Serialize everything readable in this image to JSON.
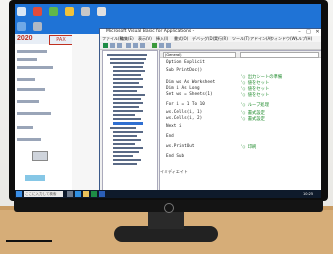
{
  "vbe": {
    "title": "Microsoft Visual Basic for Applications - ",
    "menu": [
      "ファイル(F)",
      "編集(E)",
      "表示(V)",
      "挿入(I)",
      "書式(O)",
      "デバッグ(D)",
      "実行(R)",
      "ツール(T)",
      "アドイン(A)",
      "ウィンドウ(W)",
      "ヘルプ(H)"
    ],
    "code_dropdown_left": "(General)",
    "code_dropdown_right": "",
    "code_lines": [
      "Option Explicit",
      "Sub PrintDoc()",
      "  Dim ws As Worksheet",
      "  Dim i As Long",
      "  Set ws = Sheets(1)",
      "  For i = 1 To 10",
      "    ws.Cells(i, 1)",
      "    ws.Cells(i, 2)",
      "  Next i",
      "  End",
      "  ws.PrintOut",
      "End Sub"
    ],
    "comments": [
      "'○ 出力シートの準備",
      "'○ 値をセット",
      "'○ 値をセット",
      "'○ 値をセット",
      "'○ ループ処理",
      "'○ 書式設定",
      "'○ 書式設定",
      "'○ 印刷"
    ],
    "immediate_label": "イミディエイト"
  },
  "pdf": {
    "year": "2020",
    "badge": "PAX"
  },
  "taskbar": {
    "search_placeholder": "ここに入力して検索",
    "clock": "10:25"
  },
  "colors": {
    "desktop": "#1f73d6",
    "code_comment": "#1d8a2a",
    "accent": "#c03020"
  }
}
